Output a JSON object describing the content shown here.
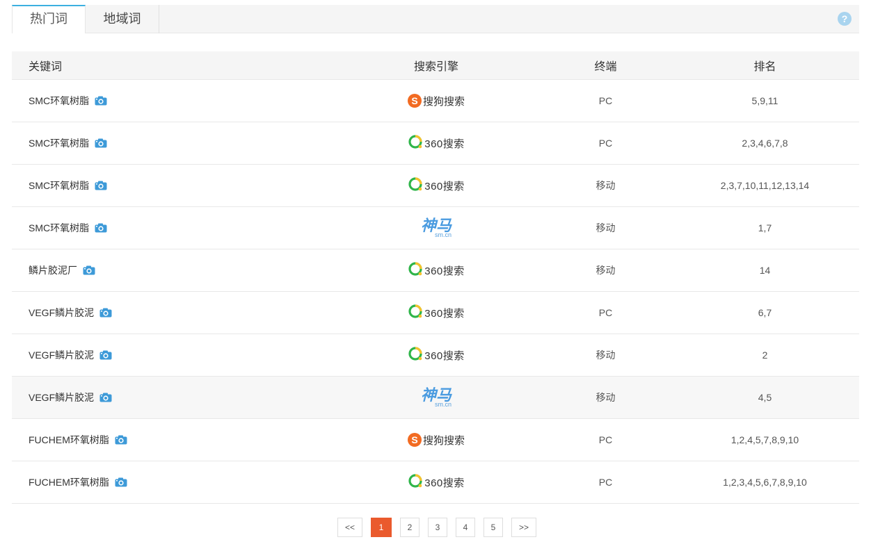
{
  "tabs": [
    {
      "label": "热门词",
      "active": true
    },
    {
      "label": "地域词",
      "active": false
    }
  ],
  "help_icon": "question-circle-icon",
  "table": {
    "headers": [
      "关键词",
      "搜索引擎",
      "终端",
      "排名"
    ],
    "rows": [
      {
        "keyword": "SMC环氧树脂",
        "engine": "sogou",
        "terminal": "PC",
        "rank": "5,9,11"
      },
      {
        "keyword": "SMC环氧树脂",
        "engine": "360",
        "terminal": "PC",
        "rank": "2,3,4,6,7,8"
      },
      {
        "keyword": "SMC环氧树脂",
        "engine": "360",
        "terminal": "移动",
        "rank": "2,3,7,10,11,12,13,14"
      },
      {
        "keyword": "SMC环氧树脂",
        "engine": "shenma",
        "terminal": "移动",
        "rank": "1,7"
      },
      {
        "keyword": "鳞片胶泥厂",
        "engine": "360",
        "terminal": "移动",
        "rank": "14"
      },
      {
        "keyword": "VEGF鳞片胶泥",
        "engine": "360",
        "terminal": "PC",
        "rank": "6,7"
      },
      {
        "keyword": "VEGF鳞片胶泥",
        "engine": "360",
        "terminal": "移动",
        "rank": "2"
      },
      {
        "keyword": "VEGF鳞片胶泥",
        "engine": "shenma",
        "terminal": "移动",
        "rank": "4,5"
      },
      {
        "keyword": "FUCHEM环氧树脂",
        "engine": "sogou",
        "terminal": "PC",
        "rank": "1,2,4,5,7,8,9,10"
      },
      {
        "keyword": "FUCHEM环氧树脂",
        "engine": "360",
        "terminal": "PC",
        "rank": "1,2,3,4,5,6,7,8,9,10"
      }
    ]
  },
  "engines": {
    "sogou": {
      "text": "搜狗搜索",
      "mark": "S",
      "color": "#f26b22"
    },
    "360": {
      "text": "360搜索",
      "color": "#2fb54a"
    },
    "shenma": {
      "text": "神马",
      "sub": "sm.cn",
      "color": "#4a9be0"
    }
  },
  "highlight_row": 7,
  "pagination": {
    "prev": "<<",
    "pages": [
      "1",
      "2",
      "3",
      "4",
      "5"
    ],
    "current": "1",
    "next": ">>",
    "current_color": "#ea5a2d"
  }
}
